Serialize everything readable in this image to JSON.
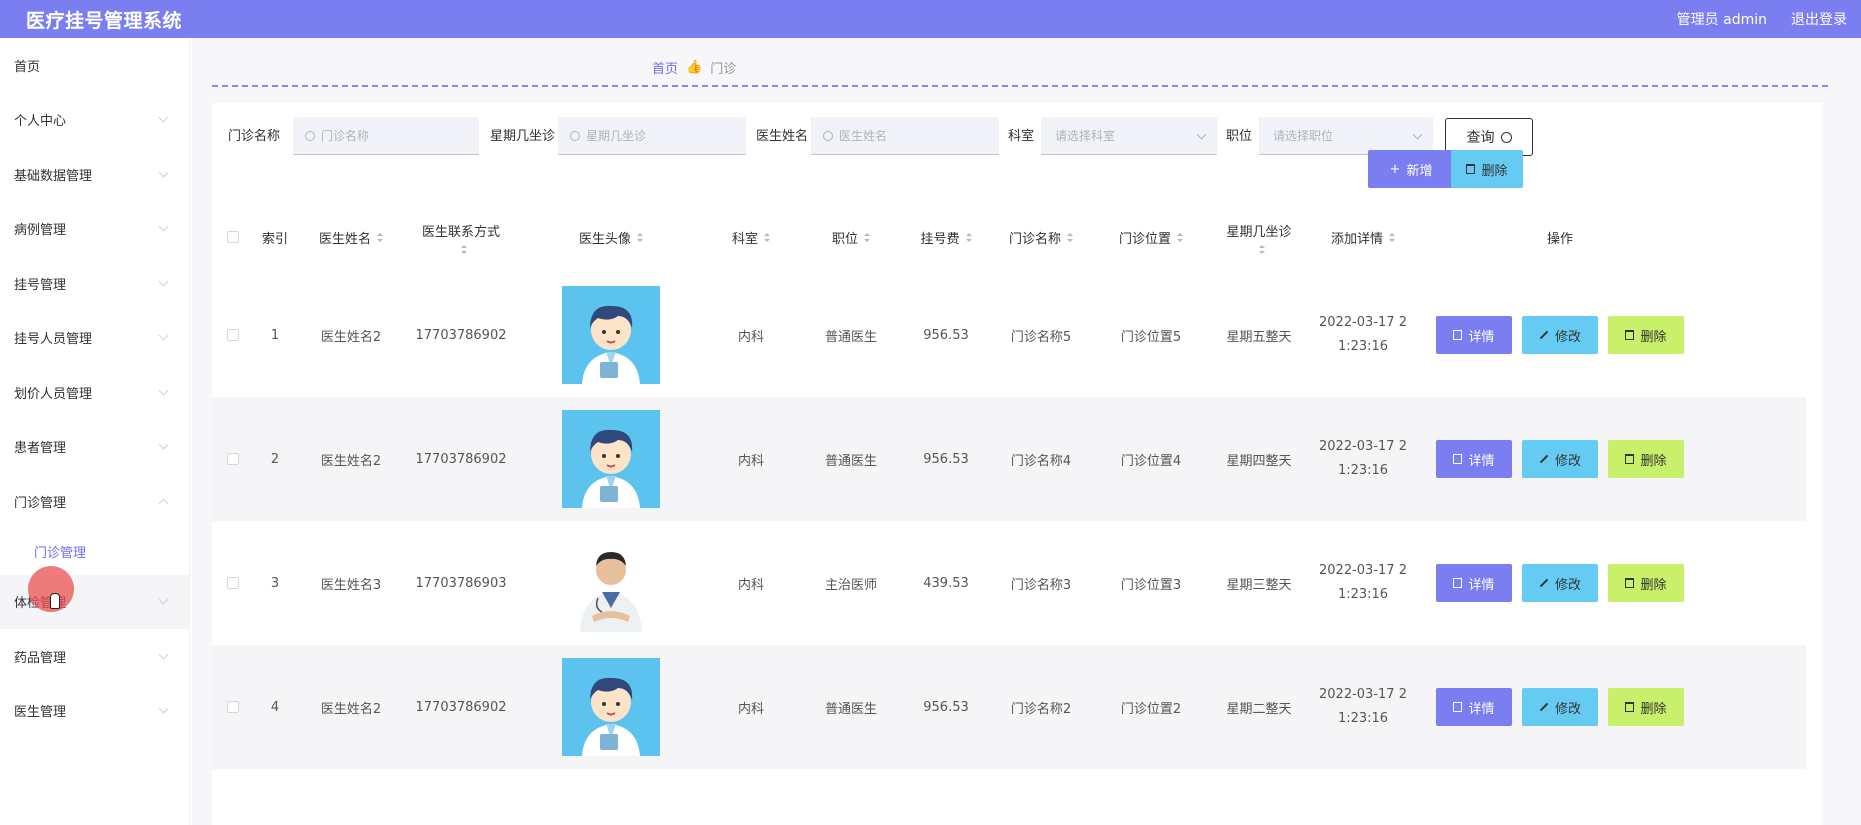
{
  "header": {
    "title": "医疗挂号管理系统",
    "user": "管理员 admin",
    "logout": "退出登录",
    "accent": "#7b7ef0"
  },
  "sidebar": {
    "items": [
      "首页",
      "个人中心",
      "基础数据管理",
      "病例管理",
      "挂号管理",
      "挂号人员管理",
      "划价人员管理",
      "患者管理",
      "门诊管理",
      "体检管理",
      "药品管理",
      "医生管理"
    ],
    "sub_item": "门诊管理"
  },
  "breadcrumb": {
    "home": "首页",
    "current": "门诊"
  },
  "search": {
    "clinic_label": "门诊名称",
    "clinic_placeholder": "门诊名称",
    "weekday_label": "星期几坐诊",
    "weekday_placeholder": "星期几坐诊",
    "doctor_label": "医生姓名",
    "doctor_placeholder": "医生姓名",
    "dept_label": "科室",
    "dept_placeholder": "请选择科室",
    "position_label": "职位",
    "position_placeholder": "请选择职位",
    "query": "查询"
  },
  "actions": {
    "add": "新增",
    "delete": "删除"
  },
  "table": {
    "headers": {
      "index": "索引",
      "doctor": "医生姓名",
      "contact_1": "医生联系方式",
      "avatar": "医生头像",
      "dept": "科室",
      "position": "职位",
      "fee": "挂号费",
      "clinic": "门诊名称",
      "location": "门诊位置",
      "weekday": "星期几坐诊",
      "added": "添加详情",
      "ops": "操作"
    },
    "rows": [
      {
        "index": "1",
        "doctor": "医生姓名2",
        "phone": "17703786902",
        "avatar": "cartoon-doctor",
        "dept": "内科",
        "position": "普通医生",
        "fee": "956.53",
        "clinic": "门诊名称5",
        "location": "门诊位置5",
        "weekday": "星期五整天",
        "date_1": "2022-03-17 2",
        "date_2": "1:23:16"
      },
      {
        "index": "2",
        "doctor": "医生姓名2",
        "phone": "17703786902",
        "avatar": "cartoon-doctor",
        "dept": "内科",
        "position": "普通医生",
        "fee": "956.53",
        "clinic": "门诊名称4",
        "location": "门诊位置4",
        "weekday": "星期四整天",
        "date_1": "2022-03-17 2",
        "date_2": "1:23:16"
      },
      {
        "index": "3",
        "doctor": "医生姓名3",
        "phone": "17703786903",
        "avatar": "photo-doctor",
        "dept": "内科",
        "position": "主治医师",
        "fee": "439.53",
        "clinic": "门诊名称3",
        "location": "门诊位置3",
        "weekday": "星期三整天",
        "date_1": "2022-03-17 2",
        "date_2": "1:23:16"
      },
      {
        "index": "4",
        "doctor": "医生姓名2",
        "phone": "17703786902",
        "avatar": "cartoon-doctor",
        "dept": "内科",
        "position": "普通医生",
        "fee": "956.53",
        "clinic": "门诊名称2",
        "location": "门诊位置2",
        "weekday": "星期二整天",
        "date_1": "2022-03-17 2",
        "date_2": "1:23:16"
      }
    ],
    "row_buttons": {
      "detail": "详情",
      "edit": "修改",
      "delete": "删除"
    }
  }
}
